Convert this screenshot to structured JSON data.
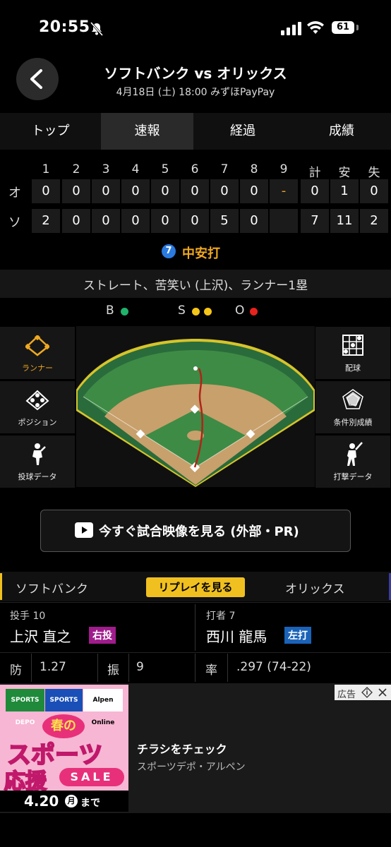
{
  "status_bar": {
    "time": "20:55",
    "battery": "61"
  },
  "header": {
    "title": "ソフトバンク vs オリックス",
    "subtitle": "4月18日 (土) 18:00 みずほPayPay"
  },
  "tabs": [
    {
      "label": "トップ"
    },
    {
      "label": "速報"
    },
    {
      "label": "経過"
    },
    {
      "label": "成績"
    }
  ],
  "scoreboard": {
    "headers": [
      "1",
      "2",
      "3",
      "4",
      "5",
      "6",
      "7",
      "8",
      "9",
      "計",
      "安",
      "失"
    ],
    "rows": [
      {
        "team": "オ",
        "cells": [
          "0",
          "0",
          "0",
          "0",
          "0",
          "0",
          "0",
          "0",
          "-",
          "0",
          "1",
          "0"
        ]
      },
      {
        "team": "ソ",
        "cells": [
          "2",
          "0",
          "0",
          "0",
          "0",
          "0",
          "5",
          "0",
          "",
          "7",
          "11",
          "2"
        ]
      }
    ]
  },
  "play": {
    "batter_no": "7",
    "result": "中安打",
    "description": "ストレート、苦笑い (上沢)、ランナー1塁"
  },
  "count": {
    "b": "B",
    "s": "S",
    "o": "O",
    "balls": 1,
    "strikes": 2,
    "outs": 1
  },
  "side_left": [
    {
      "label": "ランナー",
      "icon": "diamond-runner-icon"
    },
    {
      "label": "ポジション",
      "icon": "position-icon"
    },
    {
      "label": "投球データ",
      "icon": "pitcher-icon"
    }
  ],
  "side_right": [
    {
      "label": "配球",
      "icon": "grid-icon"
    },
    {
      "label": "条件別成績",
      "icon": "radar-icon"
    },
    {
      "label": "打撃データ",
      "icon": "batter-icon"
    }
  ],
  "video_button": {
    "label": "今すぐ試合映像を見る (外部・PR)"
  },
  "teams_bar": {
    "left": "ソフトバンク",
    "replay": "リプレイを見る",
    "right": "オリックス"
  },
  "pitcher": {
    "role": "投手 10",
    "name": "上沢 直之",
    "badge": "右投",
    "stat1_label": "防",
    "stat1_value": "1.27",
    "stat2_label": "振",
    "stat2_value": "9"
  },
  "batter": {
    "role": "打者 7",
    "name": "西川 龍馬",
    "badge": "左打",
    "stat_label": "率",
    "stat_value": ".297 (74-22)"
  },
  "ad": {
    "tag": "広告",
    "logos": [
      "SPORTS DEPO",
      "SPORTS Alpen",
      "Alpen Online"
    ],
    "headline1": "春の",
    "headline2": "スポーツ",
    "headline3": "応援",
    "sale": "SALE",
    "date": "4.20",
    "date_day": "月",
    "date_suffix": "まで",
    "title": "チラシをチェック",
    "subtitle": "スポーツデポ・アルペン"
  },
  "colors": {
    "accent": "#f0a820",
    "ball": "#1fb36b",
    "strike": "#f5c518",
    "out": "#e8221c",
    "pitcher_badge": "#a01c8c",
    "batter_badge": "#1a63b8"
  }
}
